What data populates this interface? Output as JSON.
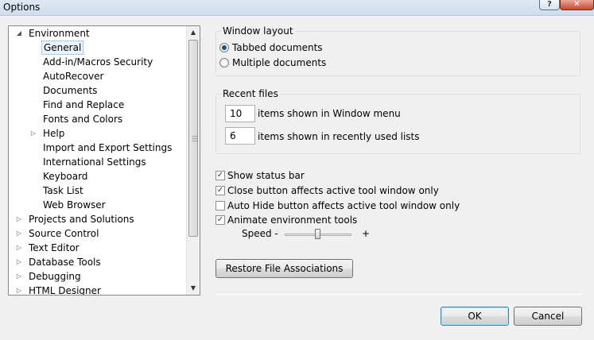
{
  "window": {
    "title": "Options",
    "help_label": "?",
    "close_label": "✕"
  },
  "tree": {
    "items": [
      {
        "label": "Environment",
        "expander": "expanded"
      },
      {
        "label": "General",
        "expander": "none",
        "selected": true
      },
      {
        "label": "Add-in/Macros Security",
        "expander": "none"
      },
      {
        "label": "AutoRecover",
        "expander": "none"
      },
      {
        "label": "Documents",
        "expander": "none"
      },
      {
        "label": "Find and Replace",
        "expander": "none"
      },
      {
        "label": "Fonts and Colors",
        "expander": "none"
      },
      {
        "label": "Help",
        "expander": "collapsed"
      },
      {
        "label": "Import and Export Settings",
        "expander": "none"
      },
      {
        "label": "International Settings",
        "expander": "none"
      },
      {
        "label": "Keyboard",
        "expander": "none"
      },
      {
        "label": "Task List",
        "expander": "none"
      },
      {
        "label": "Web Browser",
        "expander": "none"
      },
      {
        "label": "Projects and Solutions",
        "expander": "collapsed"
      },
      {
        "label": "Source Control",
        "expander": "collapsed"
      },
      {
        "label": "Text Editor",
        "expander": "collapsed"
      },
      {
        "label": "Database Tools",
        "expander": "collapsed"
      },
      {
        "label": "Debugging",
        "expander": "collapsed"
      },
      {
        "label": "HTML Designer",
        "expander": "collapsed"
      }
    ]
  },
  "window_layout": {
    "title": "Window layout",
    "options": [
      {
        "label": "Tabbed documents",
        "checked": true
      },
      {
        "label": "Multiple documents",
        "checked": false
      }
    ]
  },
  "recent_files": {
    "title": "Recent files",
    "window_menu_count": "10",
    "window_menu_label": "items shown in Window menu",
    "recent_lists_count": "6",
    "recent_lists_label": "items shown in recently used lists"
  },
  "checkboxes": [
    {
      "label": "Show status bar",
      "checked": true
    },
    {
      "label": "Close button affects active tool window only",
      "checked": true
    },
    {
      "label": "Auto Hide button affects active tool window only",
      "checked": false
    },
    {
      "label": "Animate environment tools",
      "checked": true
    }
  ],
  "speed": {
    "label": "Speed -",
    "plus": "+",
    "level": 0.5
  },
  "buttons": {
    "restore": "Restore File Associations",
    "ok": "OK",
    "cancel": "Cancel"
  }
}
